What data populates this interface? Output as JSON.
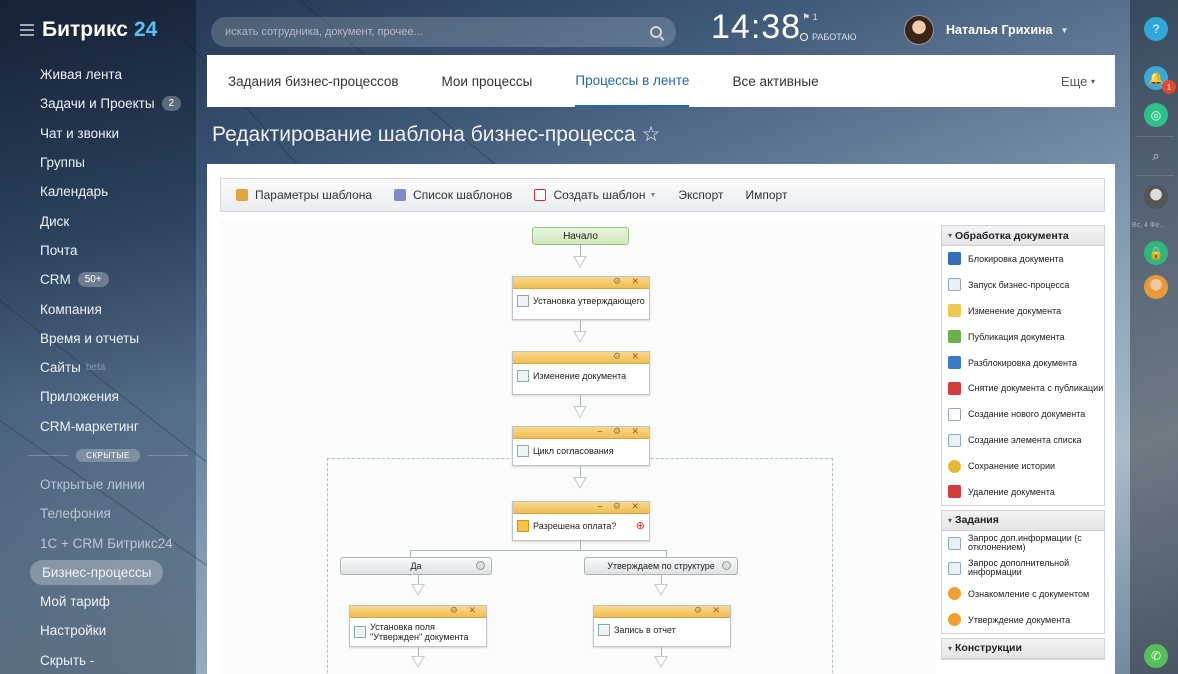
{
  "brand": {
    "name": "Битрикс",
    "number": "24"
  },
  "sidebar": {
    "items": [
      {
        "label": "Живая лента"
      },
      {
        "label": "Задачи и Проекты",
        "badge": "2"
      },
      {
        "label": "Чат и звонки"
      },
      {
        "label": "Группы"
      },
      {
        "label": "Календарь"
      },
      {
        "label": "Диск"
      },
      {
        "label": "Почта"
      },
      {
        "label": "CRM",
        "badge": "50+"
      },
      {
        "label": "Компания"
      },
      {
        "label": "Время и отчеты"
      },
      {
        "label": "Сайты",
        "beta": "beta"
      },
      {
        "label": "Приложения"
      },
      {
        "label": "CRM-маркетинг"
      }
    ],
    "hidden_label": "СКРЫТЫЕ",
    "hidden_items": [
      {
        "label": "Открытые линии"
      },
      {
        "label": "Телефония"
      },
      {
        "label": "1С + CRM Битрикс24"
      },
      {
        "label": "Бизнес-процессы",
        "active": true
      },
      {
        "label": "Мой тариф"
      },
      {
        "label": "Настройки"
      },
      {
        "label": "Скрыть -"
      }
    ]
  },
  "header": {
    "search_placeholder": "искать сотрудника, документ, прочее...",
    "time": "14:38",
    "flag_count": "1",
    "work_status": "РАБОТАЮ",
    "user_name": "Наталья Грихина"
  },
  "tabs": [
    {
      "label": "Задания бизнес-процессов"
    },
    {
      "label": "Мои процессы"
    },
    {
      "label": "Процессы в ленте",
      "active": true
    },
    {
      "label": "Все активные"
    }
  ],
  "tabs_more": "Еще",
  "page_title": "Редактирование шаблона бизнес-процесса ☆",
  "toolbar": {
    "params": "Параметры шаблона",
    "list": "Список шаблонов",
    "create": "Создать шаблон",
    "export": "Экспорт",
    "import": "Импорт"
  },
  "workflow": {
    "start": "Начало",
    "act1": "Установка утверждающего",
    "act2": "Изменение документа",
    "act3": "Цикл согласования",
    "act4": "Разрешена оплата?",
    "branch_yes": "Да",
    "branch_struct": "Утверждаем по структуре",
    "act5": "Установка поля \"Утвержден\" документа",
    "act6": "Запись в отчет"
  },
  "activities": {
    "group1": {
      "title": "Обработка документа",
      "items": [
        "Блокировка документа",
        "Запуск бизнес-процесса",
        "Изменение документа",
        "Публикация документа",
        "Разблокировка документа",
        "Снятие документа с публикации",
        "Создание нового документа",
        "Создание элемента списка",
        "Сохранение истории",
        "Удаление документа"
      ]
    },
    "group2": {
      "title": "Задания",
      "items": [
        "Запрос доп.информации (с отклонением)",
        "Запрос дополнительной информации",
        "Ознакомление с документом",
        "Утверждение документа"
      ]
    },
    "group3": {
      "title": "Конструкции"
    }
  },
  "rail": {
    "help": "?",
    "notif_count": "1",
    "date": "Вс, 4 Фе..."
  },
  "colors": {
    "accent": "#2067b0",
    "brand_num": "#58c3f0",
    "activity_header": "#efbe55",
    "start_green": "#cfe8bb"
  }
}
